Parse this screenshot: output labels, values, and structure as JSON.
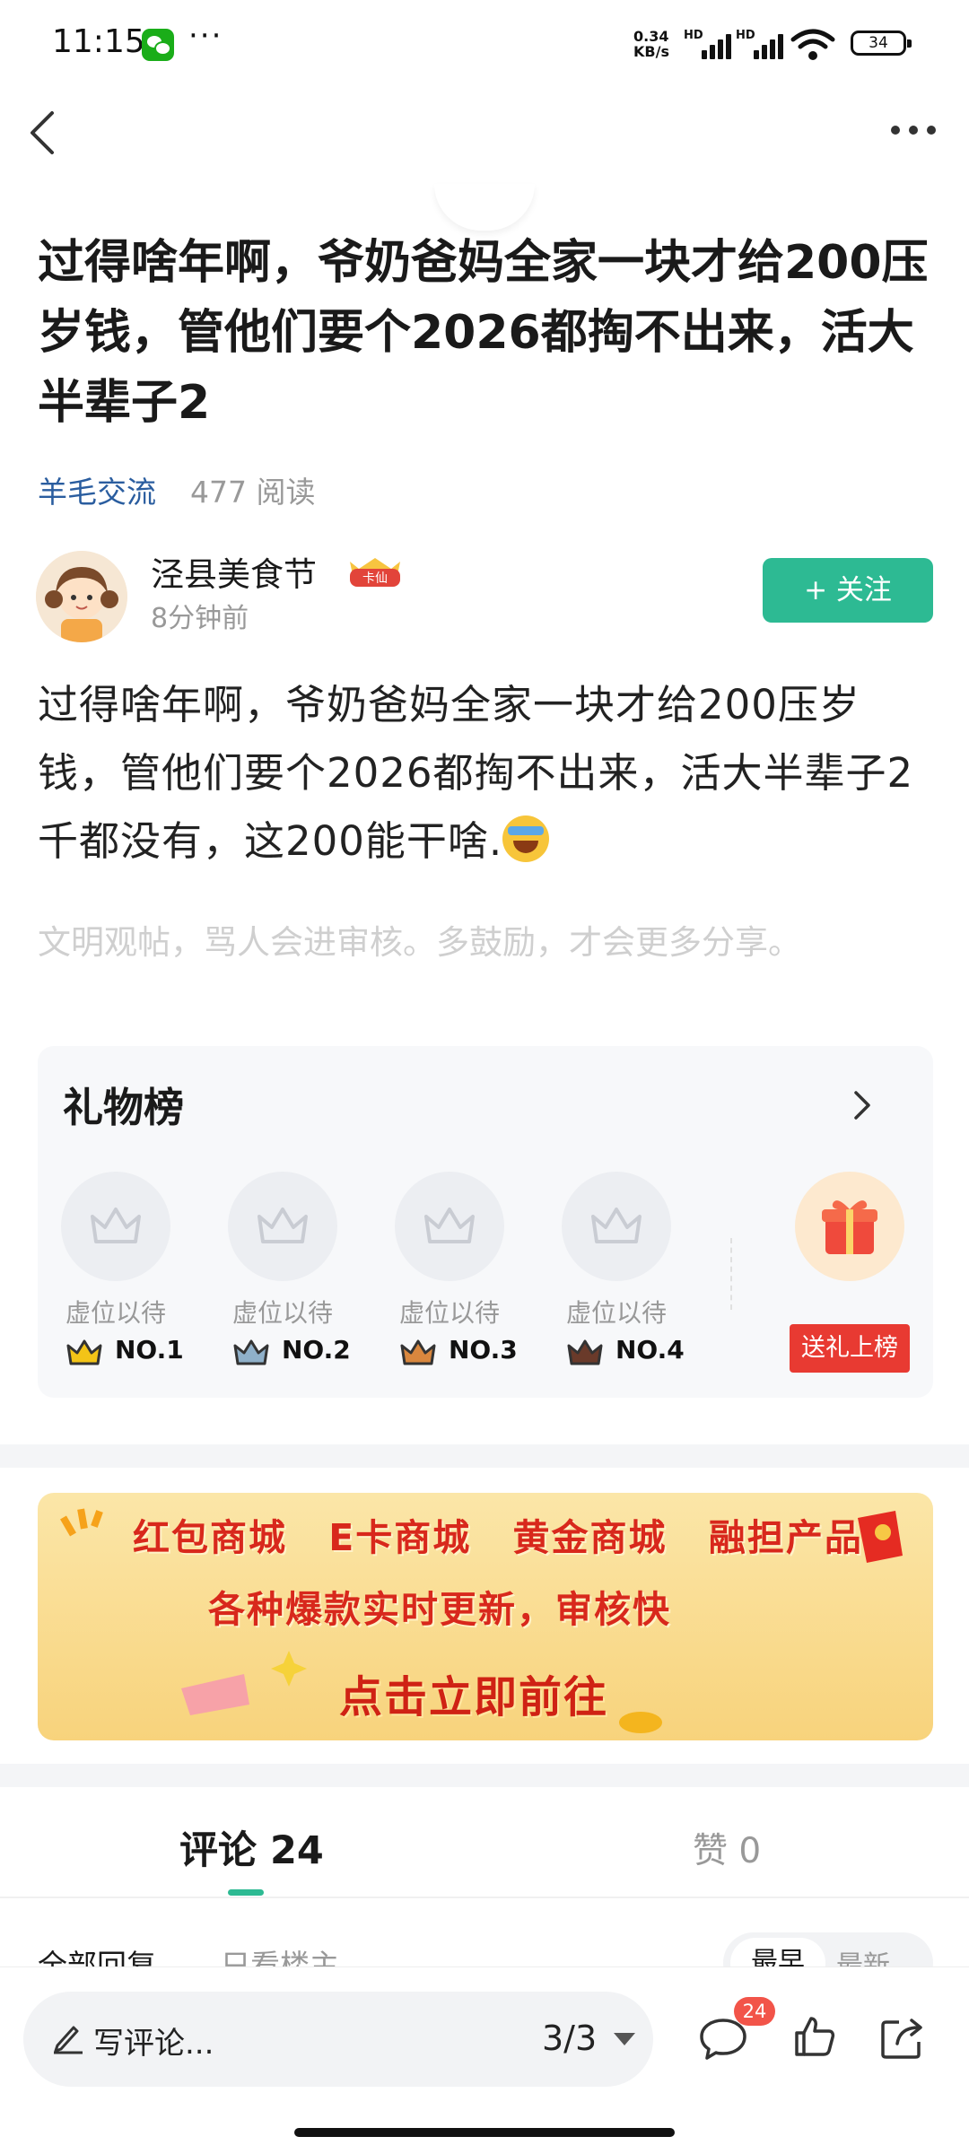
{
  "status_bar": {
    "time": "11:15",
    "net_speed_value": "0.34",
    "net_speed_unit": "KB/s",
    "hd_label": "HD",
    "battery": "34"
  },
  "post": {
    "title": "过得啥年啊，爷奶爸妈全家一块才给200压岁钱，管他们要个2026都掏不出来，活大半辈子2",
    "category": "羊毛交流",
    "read_count": "477 阅读",
    "author": {
      "name": "泾县美食节",
      "badge": "卡仙",
      "time": "8分钟前"
    },
    "follow_label": "+  关注",
    "body": "过得啥年啊，爷奶爸妈全家一块才给200压岁钱，管他们要个2026都掏不出来，活大半辈子2千都没有，这200能干啥.",
    "body_emoji": "crying-face-icon",
    "civility_note": "文明观帖，骂人会进审核。多鼓励，才会更多分享。"
  },
  "gift_board": {
    "title": "礼物榜",
    "slots": [
      {
        "label": "虚位以待",
        "rank": "NO.1",
        "rank_color": "#f3c417"
      },
      {
        "label": "虚位以待",
        "rank": "NO.2",
        "rank_color": "#8fb0c9"
      },
      {
        "label": "虚位以待",
        "rank": "NO.3",
        "rank_color": "#d9873e"
      },
      {
        "label": "虚位以待",
        "rank": "NO.4",
        "rank_color": "#6a3a2a"
      }
    ],
    "send_label": "送礼上榜"
  },
  "banner": {
    "line1": "红包商城 E卡商城 黄金商城 融担产品",
    "line2": "各种爆款实时更新，审核快",
    "line3": "点击立即前往"
  },
  "tabs": {
    "comments": "评论 24",
    "likes": "赞 0"
  },
  "comment_filters": {
    "all": "全部回复",
    "op_only": "只看楼主",
    "sort_selected": "最早",
    "sort_other": "最新"
  },
  "bottom_bar": {
    "input_placeholder": "写评论...",
    "page_indicator": "3/3",
    "comment_count": "24"
  },
  "colors": {
    "accent_green": "#2dba93",
    "tag_blue": "#2a5d9f",
    "banner_red": "#d8281c",
    "badge_red": "#f25449"
  }
}
